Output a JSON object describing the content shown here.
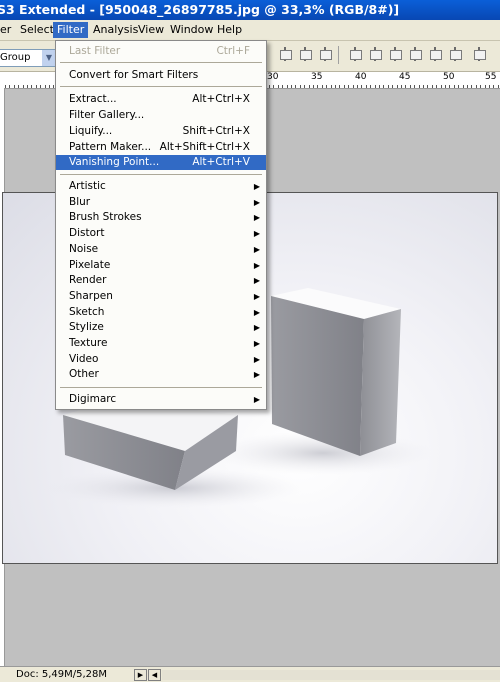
{
  "window": {
    "title": "S3 Extended - [950048_26897785.jpg @ 33,3% (RGB/8#)]"
  },
  "menubar": {
    "items": [
      "er",
      "Select",
      "Filter",
      "Analysis",
      "View",
      "Window",
      "Help"
    ],
    "active": "Filter"
  },
  "options_bar": {
    "group_value": "Group"
  },
  "ruler": {
    "labels": [
      "30",
      "35",
      "40",
      "45",
      "50",
      "55"
    ]
  },
  "filter_menu": {
    "last_filter": {
      "label": "Last Filter",
      "shortcut": "Ctrl+F"
    },
    "convert": {
      "label": "Convert for Smart Filters"
    },
    "tools": [
      {
        "label": "Extract...",
        "shortcut": "Alt+Ctrl+X"
      },
      {
        "label": "Filter Gallery...",
        "shortcut": ""
      },
      {
        "label": "Liquify...",
        "shortcut": "Shift+Ctrl+X"
      },
      {
        "label": "Pattern Maker...",
        "shortcut": "Alt+Shift+Ctrl+X"
      },
      {
        "label": "Vanishing Point...",
        "shortcut": "Alt+Ctrl+V"
      }
    ],
    "submenus": [
      "Artistic",
      "Blur",
      "Brush Strokes",
      "Distort",
      "Noise",
      "Pixelate",
      "Render",
      "Sharpen",
      "Sketch",
      "Stylize",
      "Texture",
      "Video",
      "Other"
    ],
    "digimarc": {
      "label": "Digimarc"
    },
    "highlighted": "Vanishing Point..."
  },
  "status": {
    "doc_text": "Doc: 5,49M/5,28M"
  },
  "colors": {
    "highlight": "#316ac5",
    "titlebar": "#0a5fd8"
  }
}
